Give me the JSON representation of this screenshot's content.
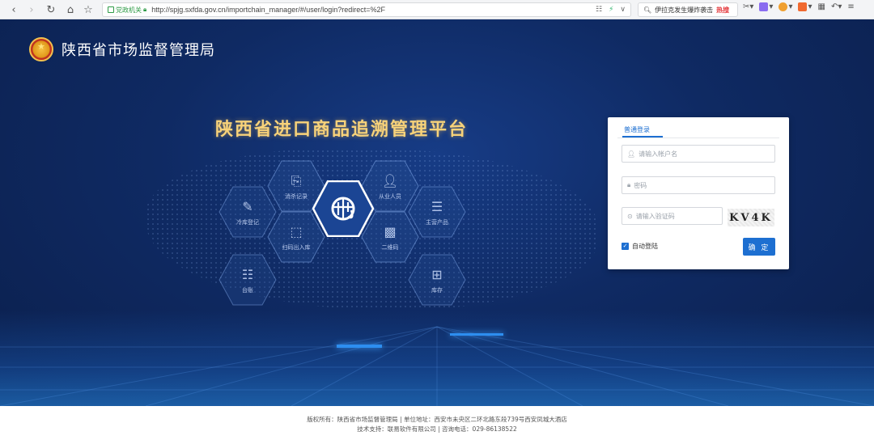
{
  "browser": {
    "secure_label": "党政机关",
    "url": "http://spjg.sxfda.gov.cn/importchain_manager/#/user/login?redirect=%2F",
    "search_text": "伊拉克发生爆炸袭击",
    "search_hot": "热搜"
  },
  "header": {
    "org_name": "陕西省市场监督管理局"
  },
  "platform": {
    "title": "陕西省进口商品追溯管理平台"
  },
  "modules": {
    "disinfect": "消杀记录",
    "staff": "从业人员",
    "warehouse_reg": "冷库登记",
    "main_products": "主营产品",
    "scan_io": "扫码出入库",
    "qrcode": "二维码",
    "ledger": "台账",
    "inventory": "库存"
  },
  "login": {
    "tab_label": "普通登录",
    "username_placeholder": "请输入帐户名",
    "password_placeholder": "密码",
    "captcha_placeholder": "请输入验证码",
    "captcha_text": "KV4K",
    "remember_label": "自动登陆",
    "remember_checked": true,
    "submit_label": "确 定"
  },
  "footer": {
    "line1": "版权所有：陕西省市场监督管理局 | 单位地址：西安市未央区二环北路东段739号西安凤城大酒店",
    "line2": "技术支持：联易软件有限公司 | 咨询电话：029-86138522"
  },
  "colors": {
    "accent": "#1d6fd1",
    "hero_bg": "#0f2a63",
    "title_gold": "#f7d27a"
  }
}
